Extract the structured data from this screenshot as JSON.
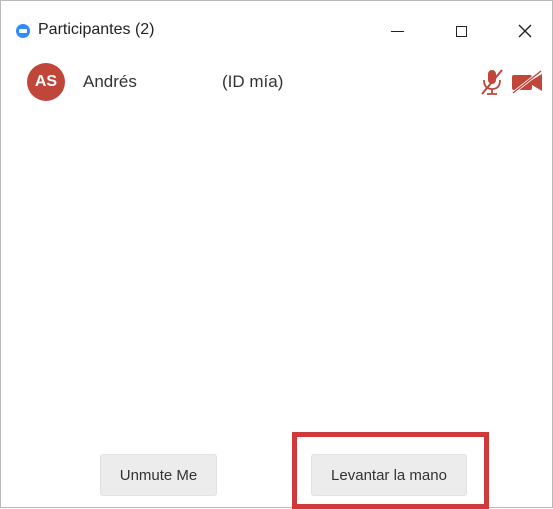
{
  "window": {
    "title": "Participantes (2)",
    "controls": {
      "minimize": "minimize-icon",
      "maximize": "maximize-icon",
      "close": "close-icon"
    }
  },
  "participants": [
    {
      "initials": "AS",
      "name": "Andrés",
      "tag": "(ID mía)",
      "avatar_color": "#c0463a",
      "mic": "muted",
      "video": "off",
      "status_color": "#c0463a"
    }
  ],
  "footer": {
    "unmute_label": "Unmute Me",
    "raise_hand_label": "Levantar la mano",
    "highlight_color": "#d03a3a"
  },
  "accent": "#2d8cff"
}
